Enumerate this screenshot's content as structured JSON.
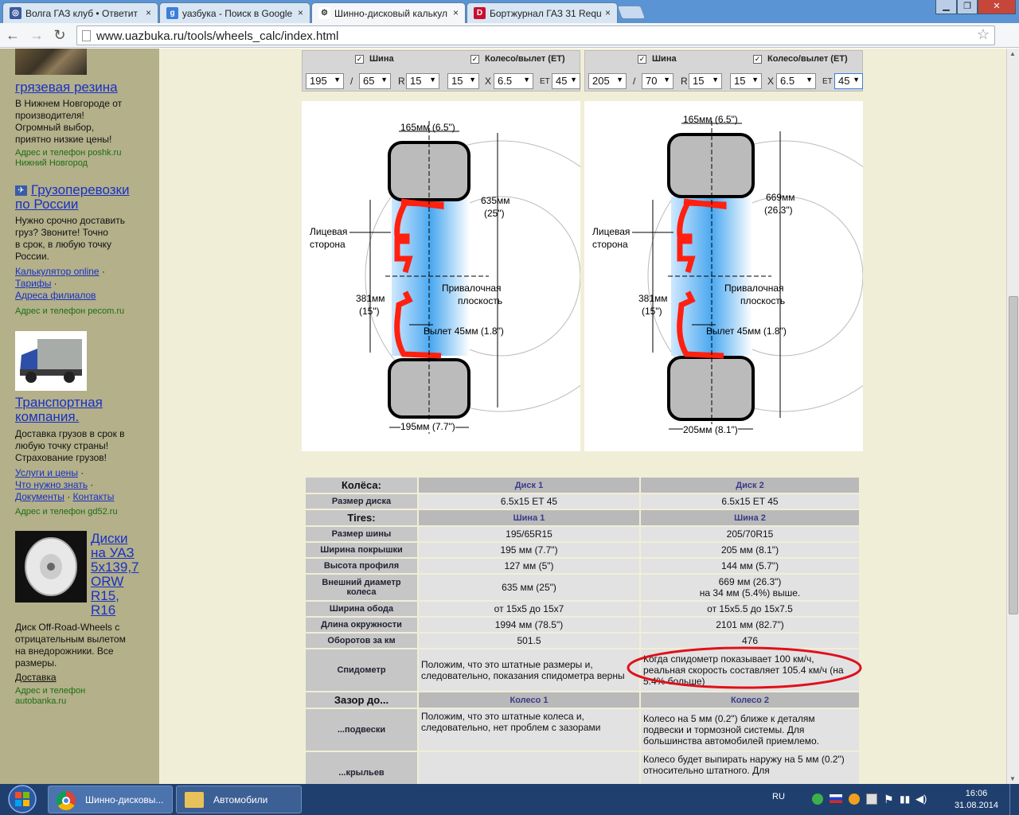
{
  "browser": {
    "tabs": [
      {
        "label": "Волга ГАЗ клуб • Ответит",
        "favicon": "gaz-club-icon"
      },
      {
        "label": "уазбука - Поиск в Google",
        "favicon": "google-icon"
      },
      {
        "label": "Шинно-дисковый калькул",
        "favicon": "wheel-icon"
      },
      {
        "label": "Бортжурнал ГАЗ 31 Requ",
        "favicon": "drive2-icon"
      }
    ],
    "url": "www.uazbuka.ru/tools/wheels_calc/index.html"
  },
  "sidebar": {
    "ad1": {
      "title": "грязевая резина",
      "text": [
        "В Нижнем Новгороде от",
        "производителя!",
        "Огромный выбор,",
        "приятно низкие цены!"
      ],
      "addr": "Адрес и телефон  poshk.ru",
      "city": "Нижний Новгород"
    },
    "ad2": {
      "title1": "Грузоперевозки",
      "title2": "по России",
      "text": [
        "Нужно срочно доставить",
        "груз? Звоните! Точно",
        "в срок, в любую точку",
        "России."
      ],
      "links": [
        "Калькулятор online",
        "Тарифы",
        "Адреса филиалов"
      ],
      "addr": "Адрес и телефон  pecom.ru"
    },
    "ad3": {
      "title1": "Транспортная",
      "title2": "компания.",
      "text": [
        "Доставка грузов в срок в",
        "любую точку страны!",
        "Страхование грузов!"
      ],
      "links": [
        "Услуги и цены",
        "Что нужно знать",
        "Документы",
        "Контакты"
      ],
      "addr": "Адрес и телефон  gd52.ru"
    },
    "ad4": {
      "title": [
        "Диски",
        "на УАЗ",
        "5x139,7",
        "ORW",
        "R15,",
        "R16"
      ],
      "text": [
        "Диск Off-Road-Wheels с",
        "отрицательным вылетом",
        "на внедорожники. Все",
        "размеры."
      ],
      "link": "Доставка",
      "addr": "Адрес и телефон",
      "site": "autobanka.ru"
    }
  },
  "config": {
    "tire_label": "Шина",
    "wheel_label": "Колесо/вылет (ET)",
    "left": {
      "width": "195",
      "profile": "65",
      "r_label": "R",
      "radius": "15",
      "rim": "15",
      "x_label": "X",
      "rim_width": "6.5",
      "et_label": "ET",
      "et": "45"
    },
    "right": {
      "width": "205",
      "profile": "70",
      "r_label": "R",
      "radius": "15",
      "rim": "15",
      "x_label": "X",
      "rim_width": "6.5",
      "et_label": "ET",
      "et": "45"
    },
    "slash": "/"
  },
  "diagrams": {
    "left": {
      "top_width": "165мм (6.5\")",
      "diam1": "635мм",
      "diam2": "(25\")",
      "face1": "Лицевая",
      "face2": "сторона",
      "rim1": "381мм",
      "rim2": "(15\")",
      "mount1": "Привалочная",
      "mount2": "плоскость",
      "offset": "Вылет 45мм (1.8\")",
      "bottom_width": "195мм (7.7\")"
    },
    "right": {
      "top_width": "165мм (6.5\")",
      "diam1": "669мм",
      "diam2": "(26.3\")",
      "face1": "Лицевая",
      "face2": "сторона",
      "rim1": "381мм",
      "rim2": "(15\")",
      "mount1": "Привалочная",
      "mount2": "плоскость",
      "offset": "Вылет 45мм (1.8\")",
      "bottom_width": "205мм (8.1\")"
    }
  },
  "results": {
    "wheels_header": "Колёса:",
    "disk1": "Диск 1",
    "disk2": "Диск 2",
    "rows_disk": [
      {
        "label": "Размер диска",
        "v1": "6.5x15 ET 45",
        "v2": "6.5x15 ET 45"
      }
    ],
    "tires_header": "Tires:",
    "tire1": "Шина 1",
    "tire2": "Шина 2",
    "rows_tire": [
      {
        "label": "Размер шины",
        "v1": "195/65R15",
        "v2": "205/70R15"
      },
      {
        "label": "Ширина покрышки",
        "v1": "195 мм (7.7\")",
        "v2": "205 мм (8.1\")"
      },
      {
        "label": "Высота профиля",
        "v1": "127 мм (5\")",
        "v2": "144 мм (5.7\")"
      }
    ],
    "outer": {
      "label": "Внешний диаметр колеса",
      "v1": "635 мм (25\")",
      "v2a": "669 мм (26.3\")",
      "v2b": "на 34 мм (5.4%) выше."
    },
    "rows_tire2": [
      {
        "label": "Ширина обода",
        "v1": "от 15x5 до 15x7",
        "v2": "от 15x5.5 до 15x7.5"
      },
      {
        "label": "Длина окружности",
        "v1": "1994 мм (78.5\")",
        "v2": "2101 мм (82.7\")"
      },
      {
        "label": "Оборотов за км",
        "v1": "501.5",
        "v2": "476"
      }
    ],
    "speedo": {
      "label": "Спидометр",
      "v1": "Положим, что это штатные размеры и, следовательно, показания спидометра верны",
      "v2": "Когда спидометр показывает 100 км/ч, реальная скорость составляет 105.4 км/ч (на 5.4% больше)"
    },
    "gap_header": "Зазор до...",
    "wheel1": "Колесо 1",
    "wheel2": "Колесо 2",
    "susp": {
      "label": "...подвески",
      "v1": "Положим, что это штатные колеса и, следовательно, нет проблем с зазорами",
      "v2": "Колесо на 5 мм (0.2\") ближе к деталям подвески и тормозной системы. Для большинства автомобилей приемлемо."
    },
    "fend": {
      "label": "...крыльев",
      "v1": "",
      "v2": "Колесо будет выпирать наружу на 5 мм (0.2\") относительно штатного. Для"
    }
  },
  "taskbar": {
    "items": [
      {
        "label": "Шинно-дисковы...",
        "icon": "chrome-icon"
      },
      {
        "label": "Автомобили",
        "icon": "folder-icon"
      }
    ],
    "lang": "RU",
    "time": "16:06",
    "date": "31.08.2014"
  }
}
